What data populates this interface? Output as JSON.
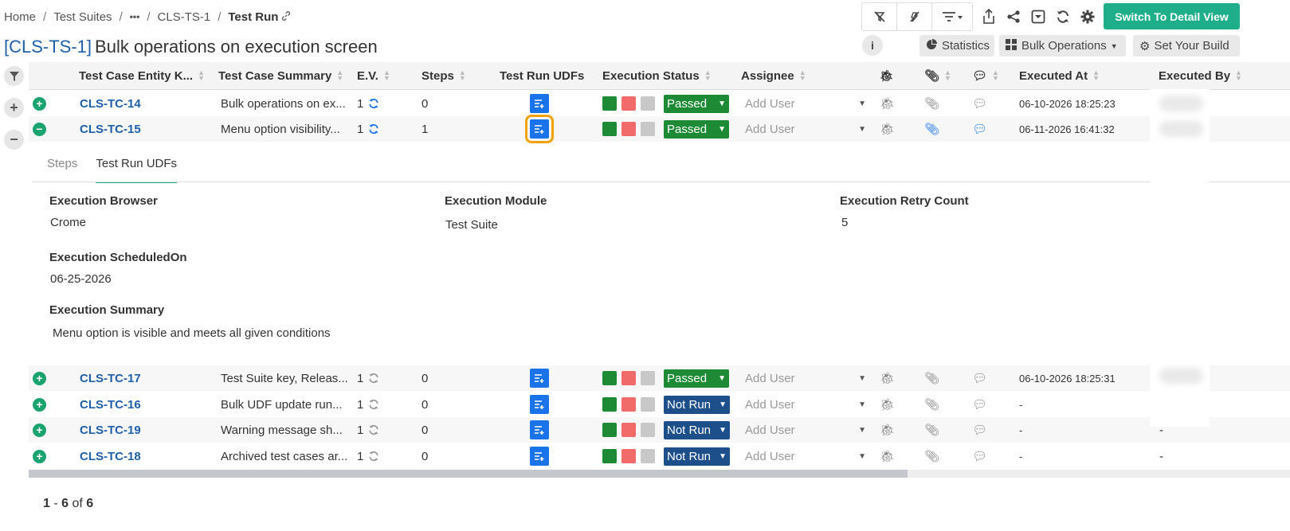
{
  "breadcrumb": {
    "home": "Home",
    "suites": "Test Suites",
    "ellipsis": "•••",
    "suite_key": "CLS-TS-1",
    "current": "Test Run"
  },
  "toolbar": {
    "switch_label": "Switch To Detail View"
  },
  "title": {
    "key": "[CLS-TS-1]",
    "text": "Bulk operations on execution screen"
  },
  "header_buttons": {
    "info": "i",
    "statistics": "Statistics",
    "bulk": "Bulk Operations",
    "build": "Set Your Build"
  },
  "columns": {
    "entity_key": "Test Case Entity K...",
    "summary": "Test Case Summary",
    "ev": "E.V.",
    "steps": "Steps",
    "udfs": "Test Run UDFs",
    "exec_status": "Execution Status",
    "assignee": "Assignee",
    "executed_at": "Executed At",
    "executed_by": "Executed By"
  },
  "rows": [
    {
      "key": "CLS-TC-14",
      "summary": "Bulk operations on ex...",
      "ev": "1",
      "steps": "0",
      "status": "Passed",
      "assignee": "Add User",
      "executed_at": "06-10-2026 18:25:23",
      "executed_by": ""
    },
    {
      "key": "CLS-TC-15",
      "summary": "Menu option visibility...",
      "ev": "1",
      "steps": "1",
      "status": "Passed",
      "assignee": "Add User",
      "executed_at": "06-11-2026 16:41:32",
      "executed_by": ""
    },
    {
      "key": "CLS-TC-17",
      "summary": "Test Suite key, Releas...",
      "ev": "1",
      "steps": "0",
      "status": "Passed",
      "assignee": "Add User",
      "executed_at": "06-10-2026 18:25:31",
      "executed_by": ""
    },
    {
      "key": "CLS-TC-16",
      "summary": "Bulk UDF update run...",
      "ev": "1",
      "steps": "0",
      "status": "Not Run",
      "assignee": "Add User",
      "executed_at": "-",
      "executed_by": ""
    },
    {
      "key": "CLS-TC-19",
      "summary": "Warning message sh...",
      "ev": "1",
      "steps": "0",
      "status": "Not Run",
      "assignee": "Add User",
      "executed_at": "-",
      "executed_by": "-"
    },
    {
      "key": "CLS-TC-18",
      "summary": "Archived test cases ar...",
      "ev": "1",
      "steps": "0",
      "status": "Not Run",
      "assignee": "Add User",
      "executed_at": "-",
      "executed_by": "-"
    }
  ],
  "panel": {
    "tab_steps": "Steps",
    "tab_udfs": "Test Run UDFs",
    "browser_label": "Execution Browser",
    "browser_value": "Crome",
    "module_label": "Execution Module",
    "module_value": "Test Suite",
    "retry_label": "Execution Retry Count",
    "retry_value": "5",
    "scheduled_label": "Execution ScheduledOn",
    "scheduled_value": "06-25-2026",
    "summary_label": "Execution Summary",
    "summary_value": "Menu option is visible and meets all given conditions"
  },
  "pager": {
    "start": "1",
    "sep": "-",
    "end": "6",
    "of": "of",
    "total": "6"
  },
  "colors": {
    "accent": "#1fae8a",
    "link": "#1f5fa8",
    "passed": "#1e8a35",
    "not_run": "#1d4f8a",
    "udf_button": "#1a73e8",
    "selected_outline": "#f0a30a"
  },
  "icons": [
    "filter-icon",
    "plus-icon",
    "minus-icon",
    "expand-icon",
    "collapse-icon",
    "refresh-icon",
    "udf-list-icon",
    "bug-icon",
    "attachment-icon",
    "comment-icon",
    "settings-icon",
    "share-icon",
    "export-icon",
    "link-icon",
    "info-icon"
  ]
}
